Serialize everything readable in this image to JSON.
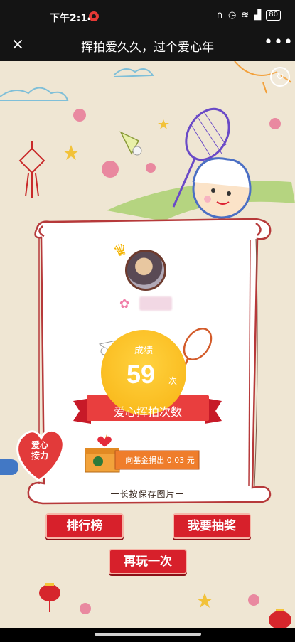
{
  "status_bar": {
    "time": "下午2:14",
    "icons": [
      "headphones-icon",
      "alarm-icon",
      "wifi-icon",
      "signal-icon",
      "battery-icon"
    ],
    "battery": "80"
  },
  "title_bar": {
    "close_icon": "×",
    "title": "挥拍爱久久，过个爱心年",
    "more_icon": "•••"
  },
  "card": {
    "score_label": "成绩",
    "score_value": "59",
    "score_unit": "次",
    "ribbon": "爱心挥拍次数",
    "donate": "向基金捐出 0.03 元",
    "save_hint": "一长按保存图片一"
  },
  "badge": {
    "line1": "爱心",
    "line2": "接力"
  },
  "buttons": {
    "rank": "排行榜",
    "draw": "我要抽奖",
    "again": "再玩一次"
  },
  "colors": {
    "background": "#efe6d3",
    "accent_red": "#d7202b",
    "score_yellow": "#f8b313"
  }
}
